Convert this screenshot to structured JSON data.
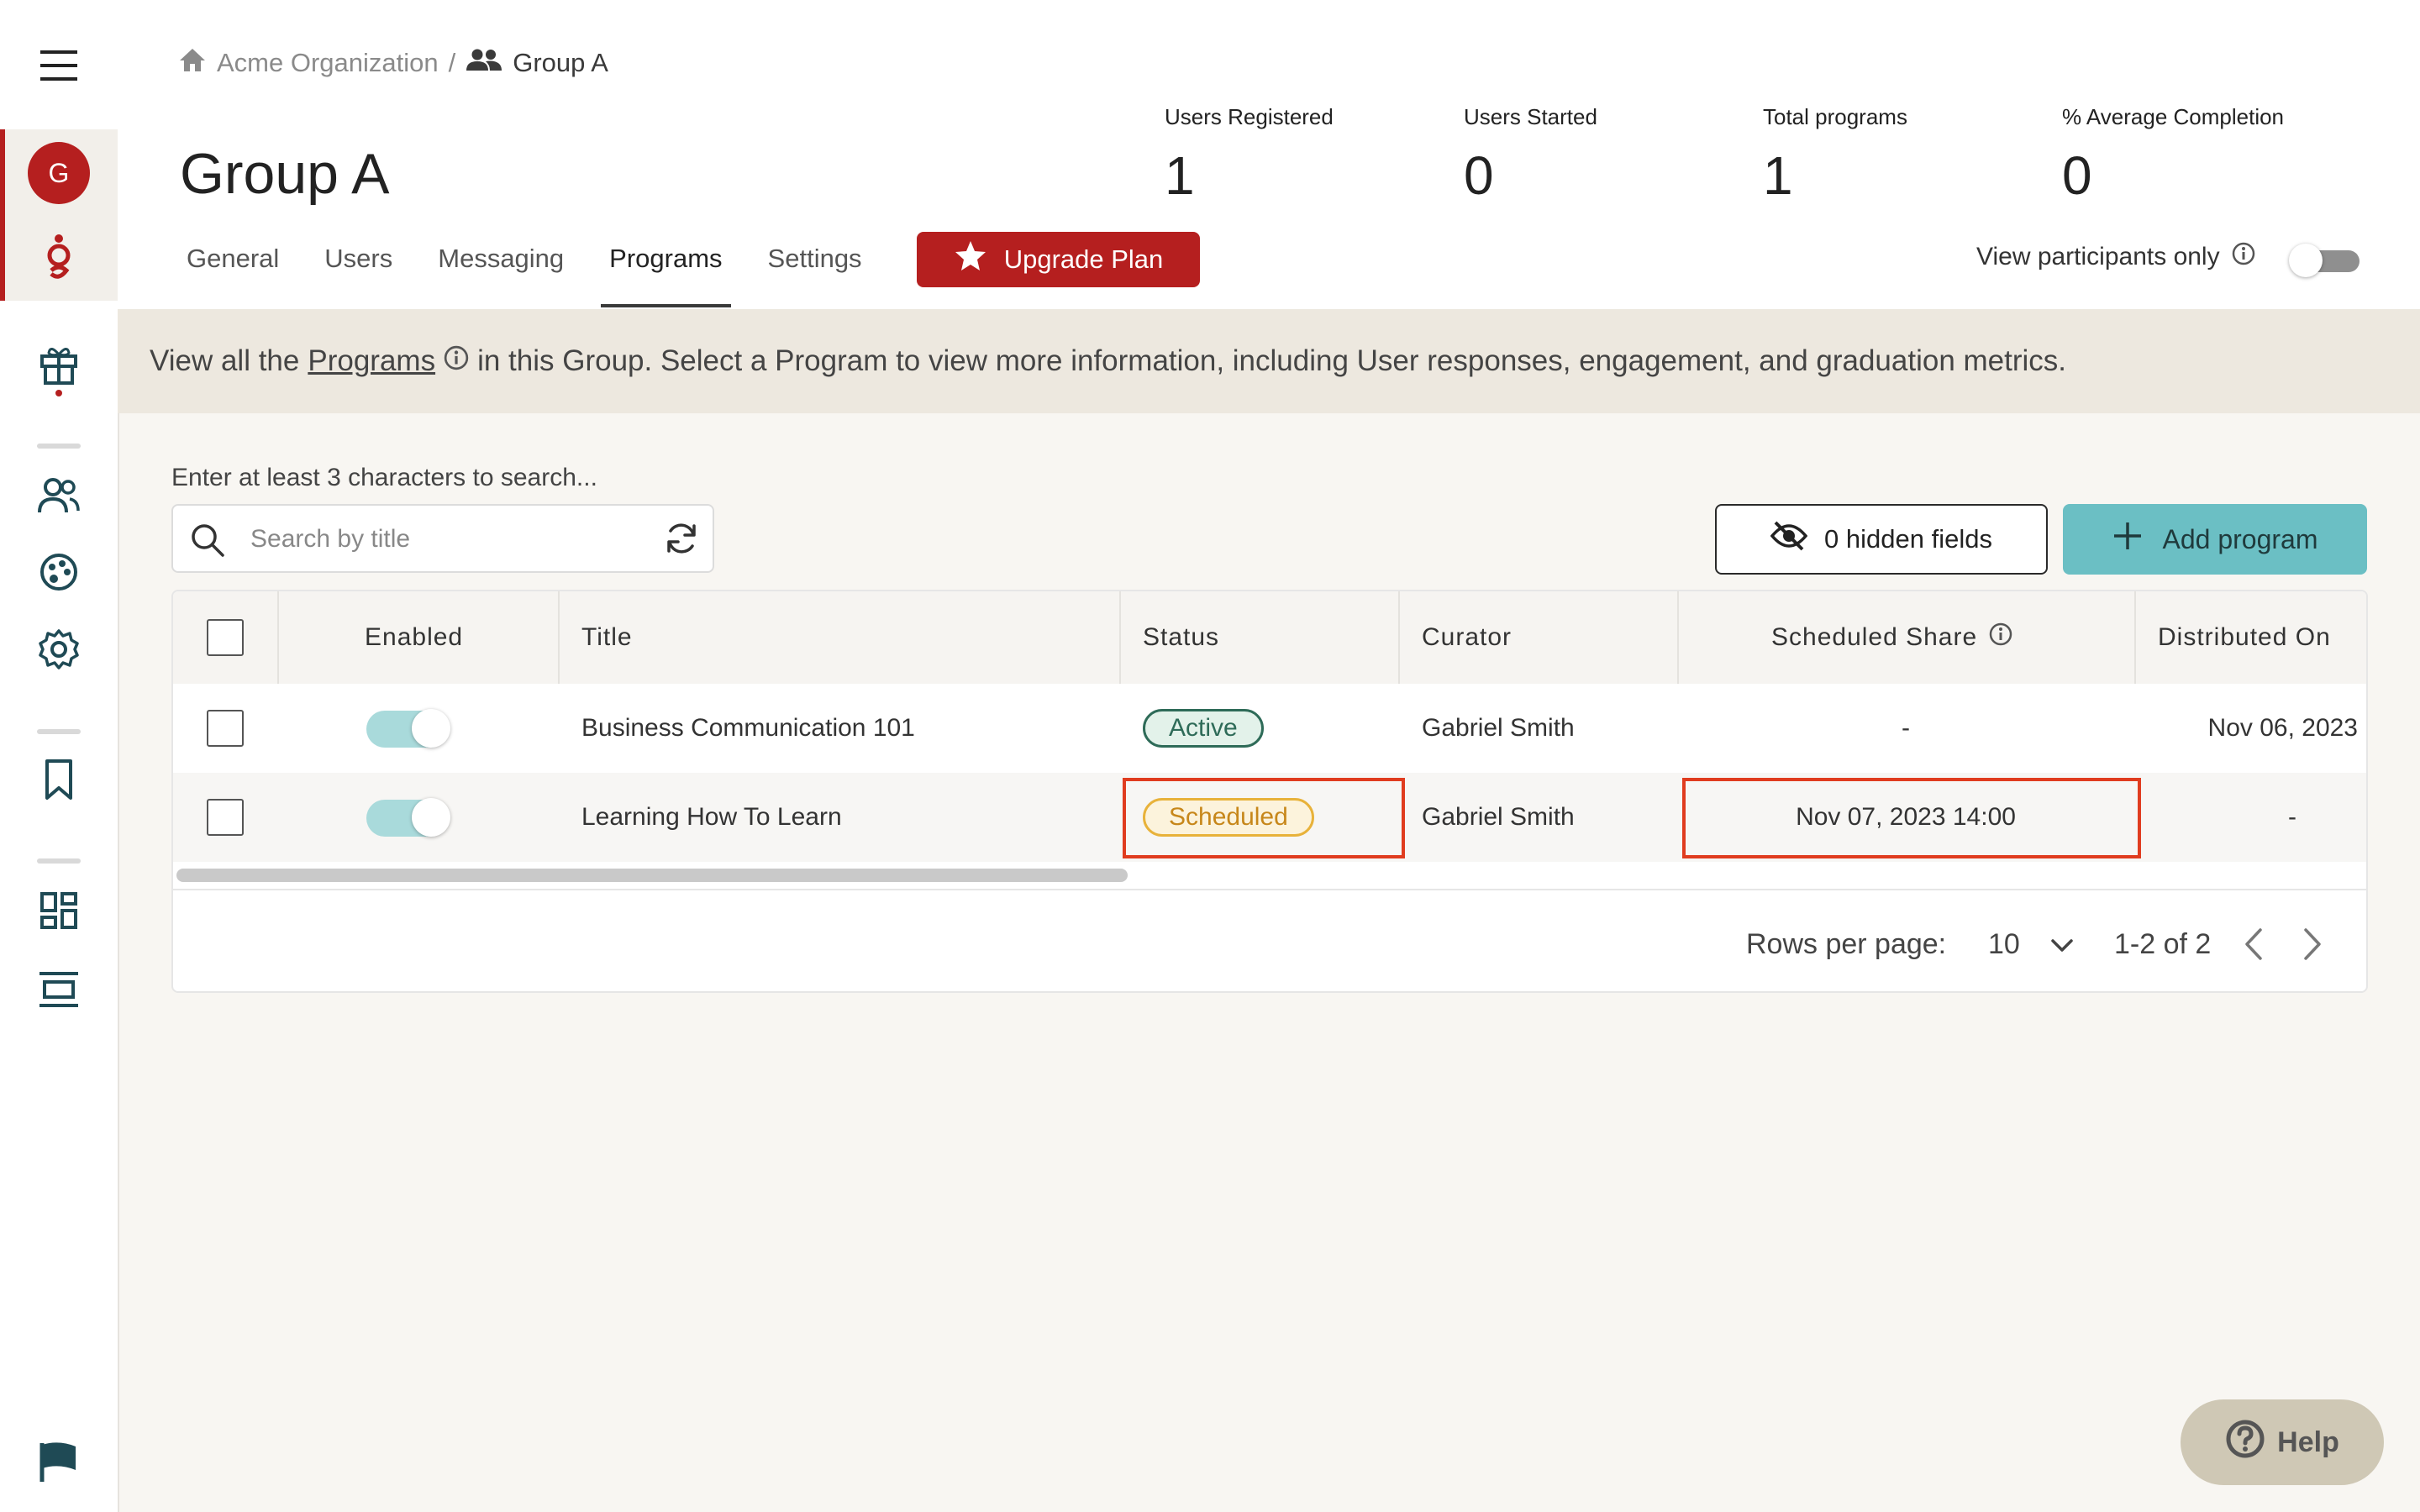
{
  "sidebar": {
    "avatar_initial": "G",
    "accent": "#b51f1f"
  },
  "breadcrumb": {
    "org": "Acme Organization",
    "separator": "/",
    "group": "Group A"
  },
  "page_title": "Group A",
  "stats": [
    {
      "label": "Users Registered",
      "value": "1"
    },
    {
      "label": "Users Started",
      "value": "0"
    },
    {
      "label": "Total programs",
      "value": "1"
    },
    {
      "label": "% Average Completion",
      "value": "0"
    }
  ],
  "tabs": [
    "General",
    "Users",
    "Messaging",
    "Programs",
    "Settings"
  ],
  "active_tab": "Programs",
  "upgrade_label": "Upgrade Plan",
  "view_participants_label": "View participants only",
  "banner": {
    "before": "View all the",
    "link": "Programs",
    "after": "in this Group. Select a Program to view more information, including User responses, engagement, and graduation metrics."
  },
  "search": {
    "hint": "Enter at least 3 characters to search...",
    "placeholder": "Search by title"
  },
  "hidden_fields_label": "0 hidden fields",
  "add_program_label": "Add program",
  "table": {
    "columns": [
      "Enabled",
      "Title",
      "Status",
      "Curator",
      "Scheduled Share",
      "Distributed On"
    ],
    "rows": [
      {
        "title": "Business Communication 101",
        "status": "Active",
        "curator": "Gabriel Smith",
        "scheduled_share": "-",
        "distributed_on": "Nov 06, 2023"
      },
      {
        "title": "Learning How To Learn",
        "status": "Scheduled",
        "curator": "Gabriel Smith",
        "scheduled_share": "Nov 07, 2023 14:00",
        "distributed_on": "-"
      }
    ]
  },
  "pagination": {
    "rows_per_page_label": "Rows per page:",
    "rows_per_page": "10",
    "range": "1-2 of 2"
  },
  "help_label": "Help"
}
